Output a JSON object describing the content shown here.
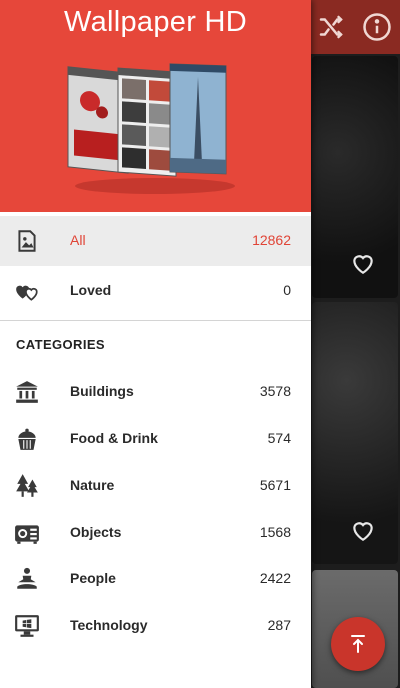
{
  "app": {
    "title": "Wallpaper HD"
  },
  "toolbar": {
    "icons": [
      "shuffle-icon",
      "info-icon"
    ]
  },
  "drawer": {
    "primary_items": [
      {
        "label": "All",
        "count": "12862",
        "icon": "image-icon",
        "selected": true
      },
      {
        "label": "Loved",
        "count": "0",
        "icon": "hearts-icon",
        "selected": false
      }
    ],
    "categories_heading": "CATEGORIES",
    "categories": [
      {
        "label": "Buildings",
        "count": "3578",
        "icon": "building-icon"
      },
      {
        "label": "Food & Drink",
        "count": "574",
        "icon": "cupcake-icon"
      },
      {
        "label": "Nature",
        "count": "5671",
        "icon": "trees-icon"
      },
      {
        "label": "Objects",
        "count": "1568",
        "icon": "radio-icon"
      },
      {
        "label": "People",
        "count": "2422",
        "icon": "meditation-icon"
      },
      {
        "label": "Technology",
        "count": "287",
        "icon": "monitor-icon"
      }
    ]
  },
  "background": {
    "card_icons": [
      "heart-outline-icon",
      "heart-outline-icon"
    ],
    "fab_icon": "scroll-to-top-icon"
  },
  "colors": {
    "accent": "#e6473a",
    "selected_text": "#e04436",
    "selected_row": "#ececec",
    "fab": "#c9352b"
  }
}
